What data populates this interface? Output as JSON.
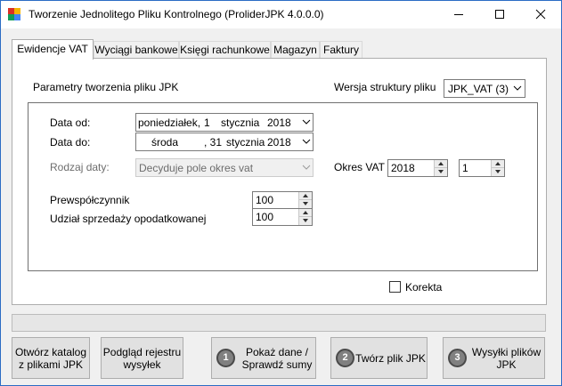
{
  "window": {
    "title": "Tworzenie Jednolitego Pliku Kontrolnego (ProliderJPK 4.0.0.0)"
  },
  "tabs": [
    {
      "label": "Ewidencje  VAT"
    },
    {
      "label": "Wyciągi bankowe"
    },
    {
      "label": "Księgi rachunkowe"
    },
    {
      "label": "Magazyn"
    },
    {
      "label": "Faktury"
    }
  ],
  "params": {
    "heading": "Parametry tworzenia pliku JPK",
    "structure_label": "Wersja struktury  pliku",
    "structure_value": "JPK_VAT (3)"
  },
  "dates": {
    "from_label": "Data od:",
    "from": {
      "weekday": "poniedziałek,",
      "day": "1",
      "month": "stycznia",
      "year": "2018"
    },
    "to_label": "Data do:",
    "to": {
      "weekday": "środa",
      "day": ", 31",
      "month": "stycznia",
      "year": "2018"
    },
    "type_label": "Rodzaj daty:",
    "type_value": "Decyduje  pole okres vat"
  },
  "period": {
    "label": "Okres VAT",
    "year": "2018",
    "month": "1"
  },
  "coefficients": {
    "prew_label": "Prewspółczynnik",
    "prew_value": "100",
    "share_label": "Udział sprzedaży opodatkowanej",
    "share_value": "100"
  },
  "korekta_label": "Korekta",
  "progress": 0,
  "buttons": {
    "catalog": "Otwórz katalog\nz plikami JPK",
    "preview": "Podgląd rejestru\nwysyłek",
    "show": "Pokaż dane /\nSprawdź sumy",
    "create": "Twórz plik JPK",
    "send": "Wysyłki plików\nJPK",
    "step1": "1",
    "step2": "2",
    "step3": "3"
  },
  "colors": {
    "accent_border": "#2b6cc4",
    "badge": "#808080"
  }
}
